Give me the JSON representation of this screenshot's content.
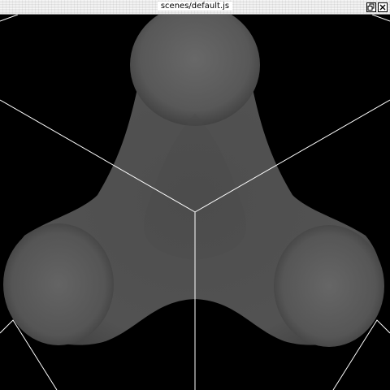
{
  "window": {
    "title": "scenes/default.js",
    "buttons": [
      {
        "name": "restore",
        "icon": "restore-window-icon"
      },
      {
        "name": "close",
        "icon": "close-icon"
      }
    ]
  },
  "scene": {
    "background": "#000000",
    "wire_color": "#ffffff",
    "object_color": "#5a5a5a",
    "object": "metaball-blob-three-lobes",
    "axes": "three axis lines meeting at center"
  }
}
